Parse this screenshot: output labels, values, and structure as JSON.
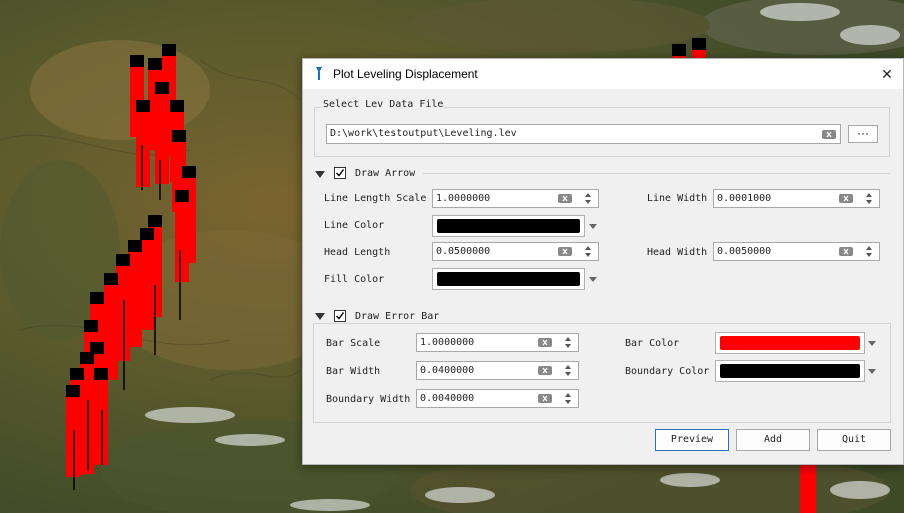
{
  "dialog": {
    "title": "Plot Leveling Displacement",
    "close_glyph": "✕"
  },
  "file_group": {
    "title": "Select Lev Data File",
    "path": "D:\\work\\testoutput\\Leveling.lev",
    "browse_label": "···"
  },
  "arrow_section": {
    "title": "Draw Arrow",
    "checked": true,
    "line_length_scale": {
      "label": "Line Length Scale",
      "value": "1.0000000"
    },
    "line_width": {
      "label": "Line Width",
      "value": "0.0001000"
    },
    "line_color": {
      "label": "Line Color",
      "color": "#000000"
    },
    "head_length": {
      "label": "Head Length",
      "value": "0.0500000"
    },
    "head_width": {
      "label": "Head Width",
      "value": "0.0050000"
    },
    "fill_color": {
      "label": "Fill Color",
      "color": "#000000"
    }
  },
  "error_section": {
    "title": "Draw Error Bar",
    "checked": true,
    "bar_scale": {
      "label": "Bar Scale",
      "value": "1.0000000"
    },
    "bar_color": {
      "label": "Bar Color",
      "color": "#ff0000"
    },
    "bar_width": {
      "label": "Bar Width",
      "value": "0.0400000"
    },
    "boundary_color": {
      "label": "Boundary Color",
      "color": "#000000"
    },
    "boundary_width": {
      "label": "Boundary Width",
      "value": "0.0040000"
    }
  },
  "buttons": {
    "preview": "Preview",
    "add": "Add",
    "quit": "Quit"
  },
  "icons": {
    "title": "pin-icon",
    "clear": "clear-icon",
    "spin": "spin-arrows-icon",
    "dropdown": "chevron-down-icon"
  },
  "colors": {
    "accent": "#2c6fc1",
    "error_bar": "#ff0000"
  }
}
